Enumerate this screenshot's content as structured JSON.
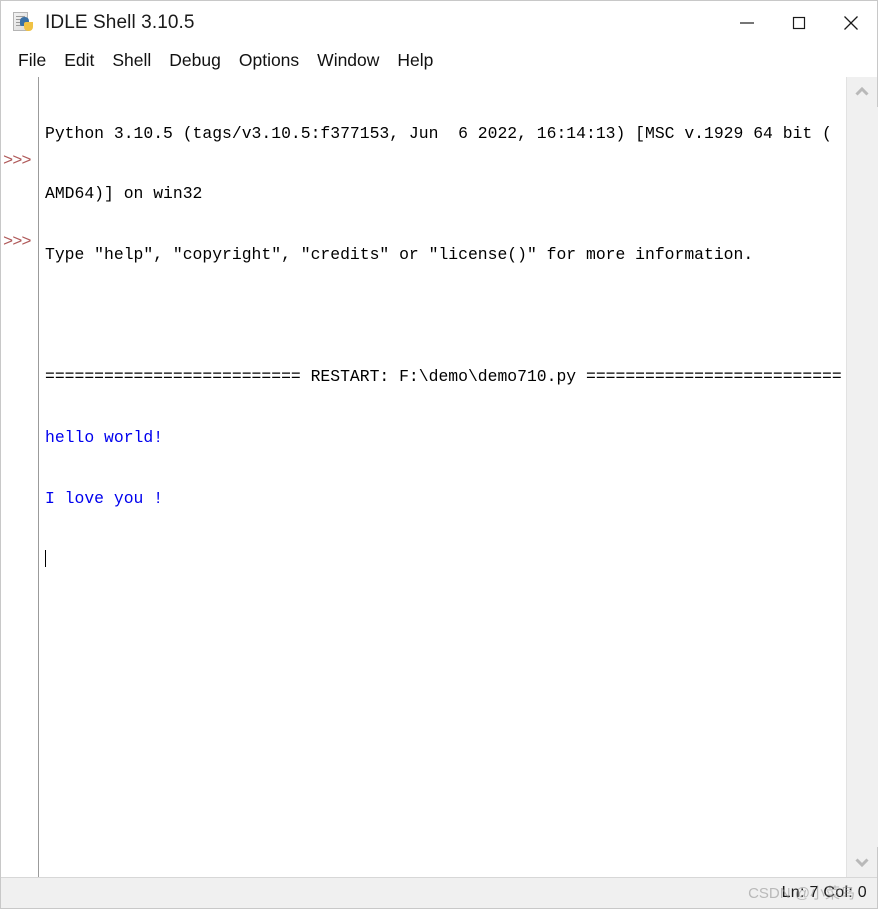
{
  "window": {
    "title": "IDLE Shell 3.10.5",
    "app_icon": "python-document-icon",
    "controls": {
      "minimize": "minimize-icon",
      "maximize": "maximize-icon",
      "close": "close-icon"
    }
  },
  "menubar": {
    "items": [
      {
        "label": "File"
      },
      {
        "label": "Edit"
      },
      {
        "label": "Shell"
      },
      {
        "label": "Debug"
      },
      {
        "label": "Options"
      },
      {
        "label": "Window"
      },
      {
        "label": "Help"
      }
    ]
  },
  "shell": {
    "prompt_symbol": ">>>",
    "prompts": [
      {
        "line_index": 3
      },
      {
        "line_index": 7
      }
    ],
    "lines": [
      {
        "text": "Python 3.10.5 (tags/v3.10.5:f377153, Jun  6 2022, 16:14:13) [MSC v.1929 64 bit (",
        "color": "black"
      },
      {
        "text": "AMD64)] on win32",
        "color": "black"
      },
      {
        "text": "Type \"help\", \"copyright\", \"credits\" or \"license()\" for more information.",
        "color": "black"
      },
      {
        "text": "",
        "color": "black"
      },
      {
        "text": "========================== RESTART: F:\\demo\\demo710.py ==========================",
        "color": "black"
      },
      {
        "text": "hello world!",
        "color": "blue"
      },
      {
        "text": "I love you !",
        "color": "blue"
      },
      {
        "text": "",
        "color": "black"
      }
    ],
    "colors": {
      "output_blue": "#0000ee",
      "stdout_black": "#000000",
      "prompt_red": "#b05a5a",
      "background": "#ffffff"
    }
  },
  "scrollbar": {
    "up_arrow": "chevron-up-icon",
    "down_arrow": "chevron-down-icon"
  },
  "statusbar": {
    "position": "Ln: 7 Col: 0",
    "watermark": "CSDN @小菜鸟"
  }
}
